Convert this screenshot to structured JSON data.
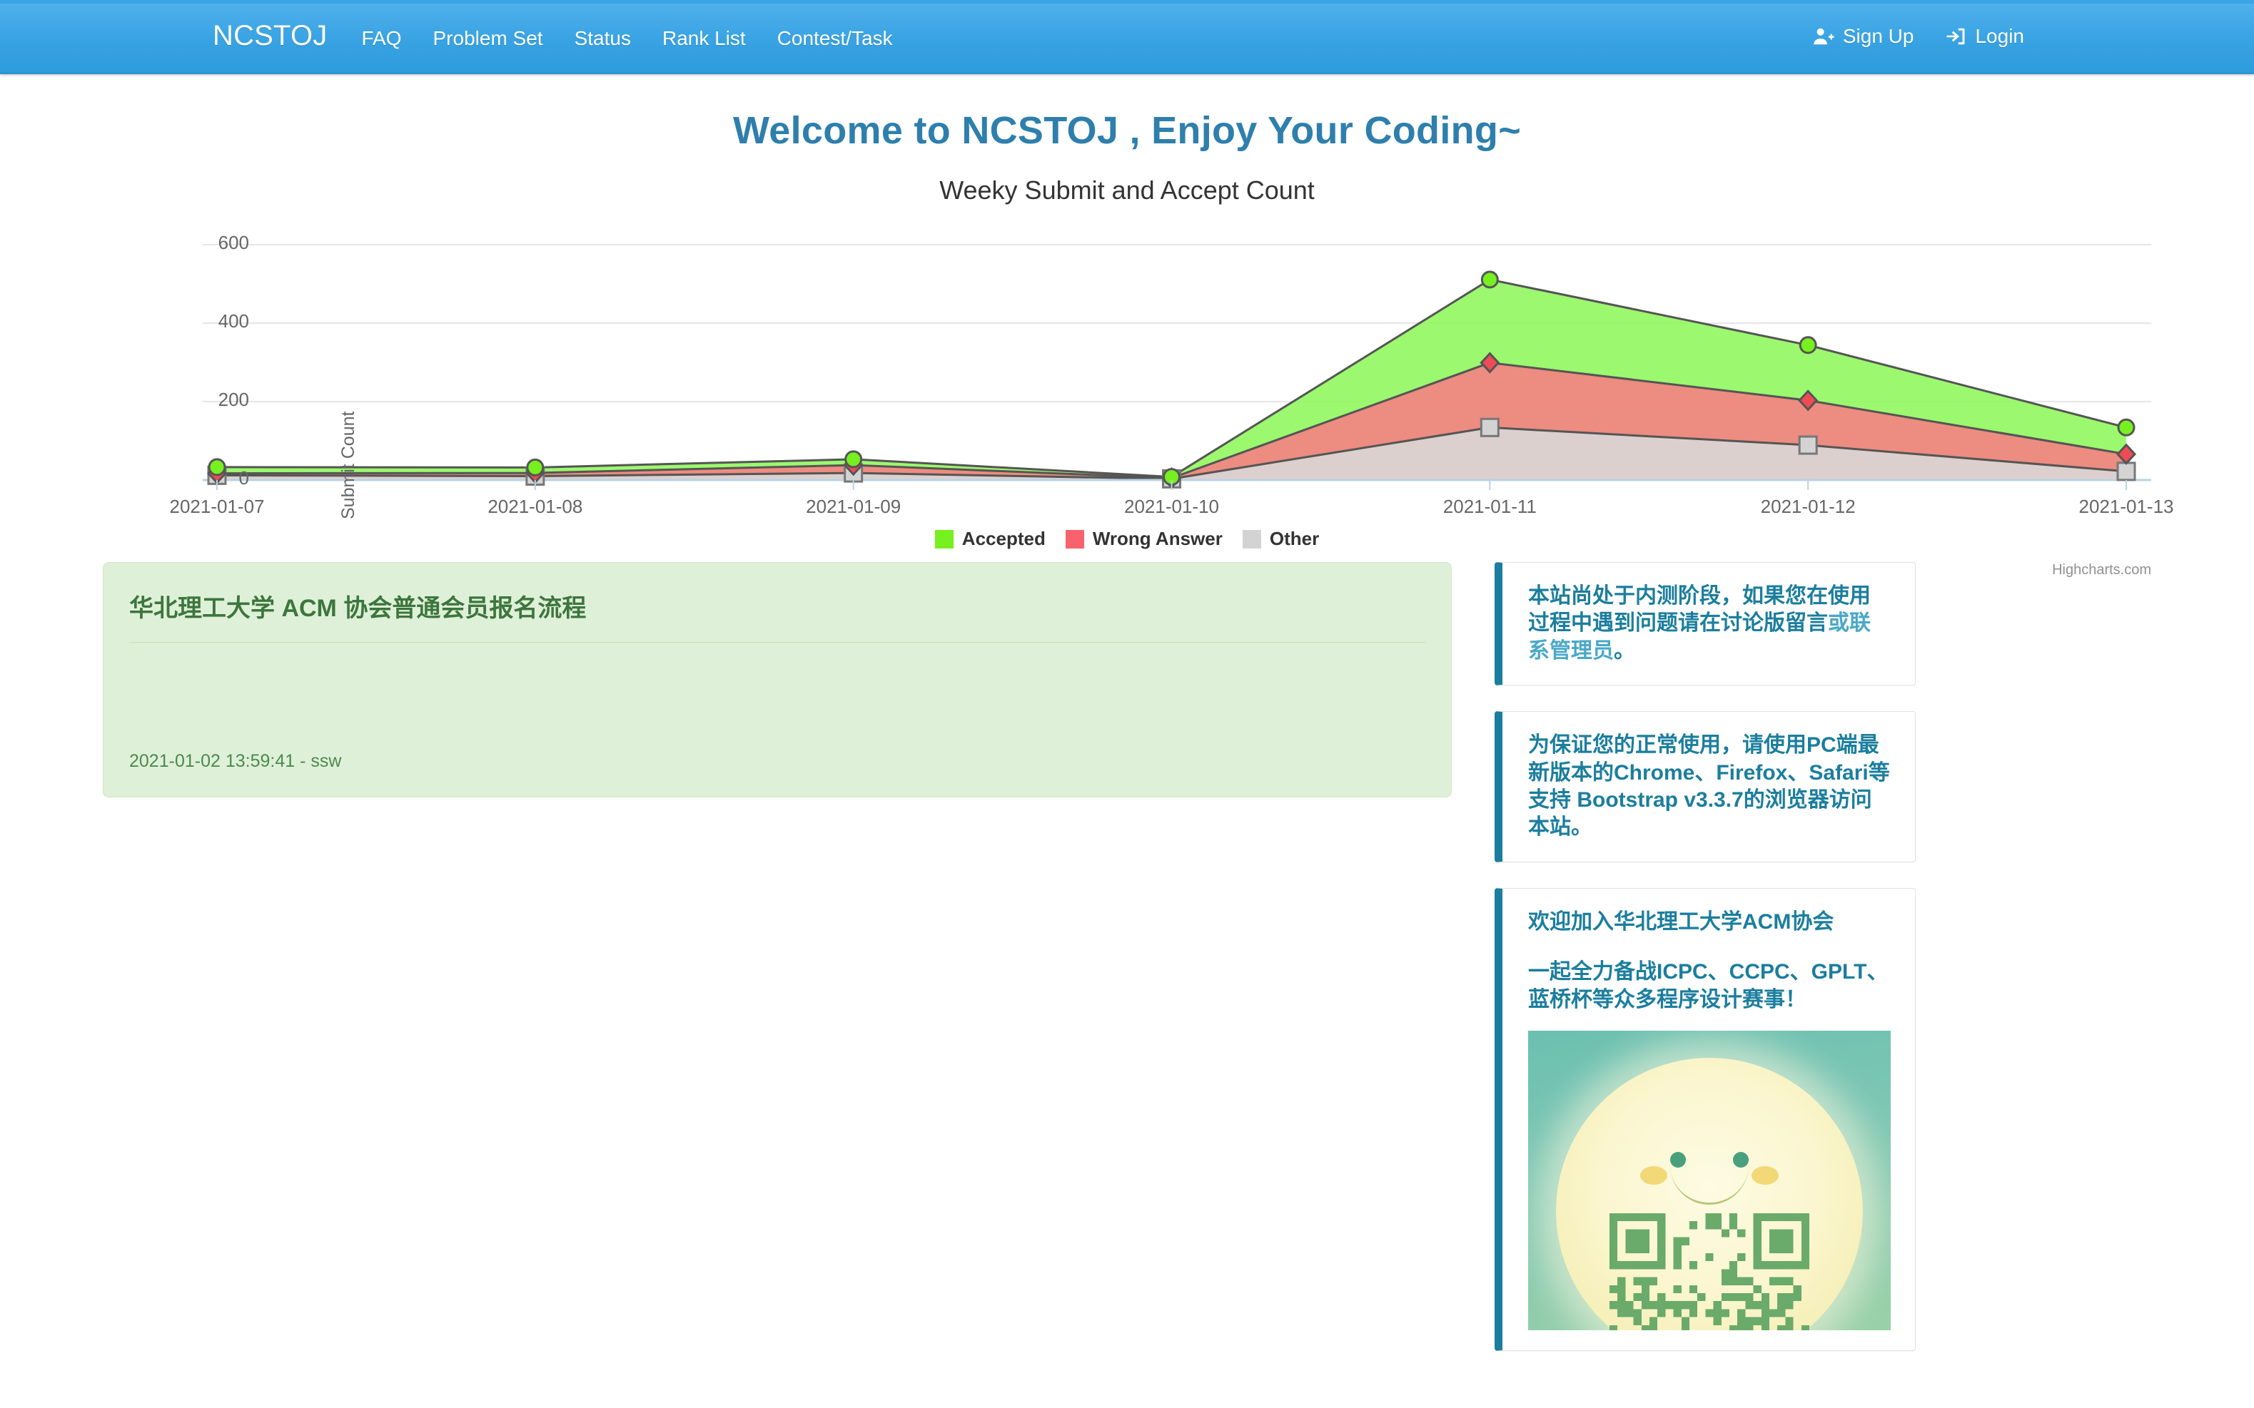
{
  "navbar": {
    "brand": "NCSTOJ",
    "items": [
      {
        "label": "FAQ",
        "name": "nav-item-faq"
      },
      {
        "label": "Problem Set",
        "name": "nav-item-problem-set"
      },
      {
        "label": "Status",
        "name": "nav-item-status"
      },
      {
        "label": "Rank List",
        "name": "nav-item-rank-list"
      },
      {
        "label": "Contest/Task",
        "name": "nav-item-contest-task"
      }
    ],
    "signup": "Sign Up",
    "login": "Login",
    "signup_icon": "user-plus-icon",
    "login_icon": "sign-in-icon",
    "background_color": "#39a3e3"
  },
  "page_title": "Welcome to NCSTOJ , Enjoy Your Coding~",
  "chart_data": {
    "type": "area",
    "stacked": true,
    "title": "Weeky Submit and Accept Count",
    "xlabel": "",
    "ylabel": "Submit Count",
    "credits": "Highcharts.com",
    "grid": true,
    "legend_position": "bottom",
    "ylim": [
      0,
      660
    ],
    "yticks": [
      0,
      200,
      400,
      600
    ],
    "categories": [
      "2021-01-07",
      "2021-01-08",
      "2021-01-09",
      "2021-01-10",
      "2021-01-11",
      "2021-01-12",
      "2021-01-13"
    ],
    "series": [
      {
        "name": "Other",
        "color": "#d3d3d3",
        "marker": "square",
        "values": [
          12,
          10,
          18,
          3,
          134,
          89,
          22
        ]
      },
      {
        "name": "Wrong Answer",
        "color": "#f8626d",
        "marker": "diamond",
        "values": [
          5,
          8,
          20,
          2,
          165,
          114,
          44
        ]
      },
      {
        "name": "Accepted",
        "color": "#76f01e",
        "marker": "circle",
        "values": [
          16,
          14,
          15,
          3,
          212,
          141,
          68
        ]
      }
    ],
    "cumulative": {
      "other": [
        12,
        10,
        18,
        3,
        134,
        89,
        22
      ],
      "wrong_answer": [
        17,
        18,
        38,
        5,
        299,
        203,
        66
      ],
      "accepted": [
        33,
        32,
        53,
        8,
        511,
        344,
        134
      ]
    },
    "legend": [
      {
        "label": "Accepted",
        "color": "#76f01e"
      },
      {
        "label": "Wrong Answer",
        "color": "#f8626d"
      },
      {
        "label": "Other",
        "color": "#d3d3d3"
      }
    ]
  },
  "post": {
    "title": "华北理工大学 ACM 协会普通会员报名流程",
    "body": "",
    "meta": "2021-01-02 13:59:41 - ssw"
  },
  "sidebar": {
    "alerts": [
      {
        "name": "alert-beta-notice",
        "paragraphs": [
          {
            "text": "本站尚处于内测阶段，如果您在使用过程中遇到问题请在讨论版留言",
            "link": "或联系管理员",
            "tail": "。"
          }
        ]
      },
      {
        "name": "alert-browser-notice",
        "paragraphs": [
          {
            "text": "为保证您的正常使用，请使用PC端最新版本的Chrome、Firefox、Safari等支持 Bootstrap v3.3.7的浏览器访问本站。",
            "link": "",
            "tail": ""
          }
        ]
      },
      {
        "name": "alert-acm-club",
        "paragraphs": [
          {
            "text": "欢迎加入华北理工大学ACM协会",
            "link": "",
            "tail": ""
          },
          {
            "text": "一起全力备战ICPC、CCPC、GPLT、蓝桥杯等众多程序设计赛事！",
            "link": "",
            "tail": ""
          }
        ],
        "image": "qr-code-poster"
      }
    ]
  },
  "colors": {
    "brand_blue": "#39a3e3",
    "title_blue": "#2e7fad",
    "alert_blue": "#1b7e9e",
    "link_blue": "#4aa8c7",
    "post_green_bg": "#dff0d8",
    "post_green_text": "#3c763d"
  }
}
